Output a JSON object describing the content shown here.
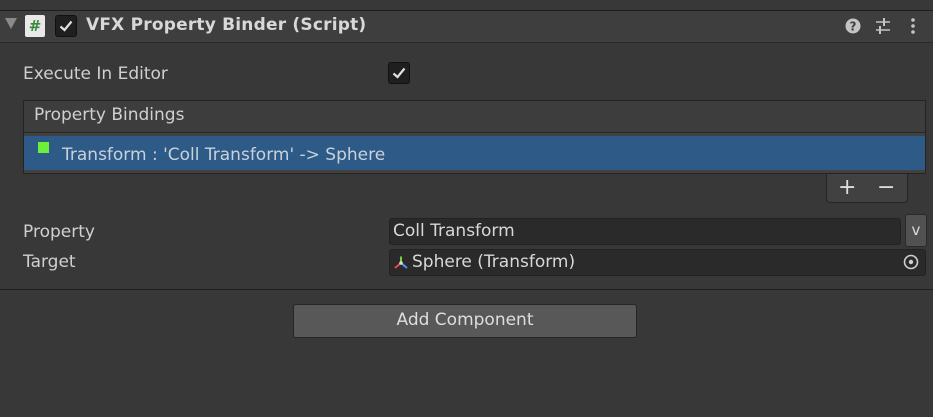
{
  "component": {
    "title": "VFX Property Binder (Script)",
    "script_icon_glyph": "#",
    "enabled": true,
    "header_icons": [
      "help-icon",
      "presets-icon",
      "more-options-icon"
    ]
  },
  "execute_in_editor": {
    "label": "Execute In Editor",
    "checked": true
  },
  "property_bindings": {
    "title": "Property Bindings",
    "items": [
      {
        "text": "Transform : 'Coll Transform' -> Sphere",
        "status_color": "#6bf13a",
        "selected": true
      }
    ],
    "add_label": "+",
    "remove_label": "−"
  },
  "property": {
    "label": "Property",
    "value": "Coll Transform",
    "dropdown_label": "v"
  },
  "target": {
    "label": "Target",
    "value": "Sphere (Transform)",
    "icon": "transform-icon"
  },
  "add_component": {
    "label": "Add Component"
  },
  "colors": {
    "background": "#383838",
    "selection": "#2d5a86",
    "accent_green": "#6bf13a"
  }
}
